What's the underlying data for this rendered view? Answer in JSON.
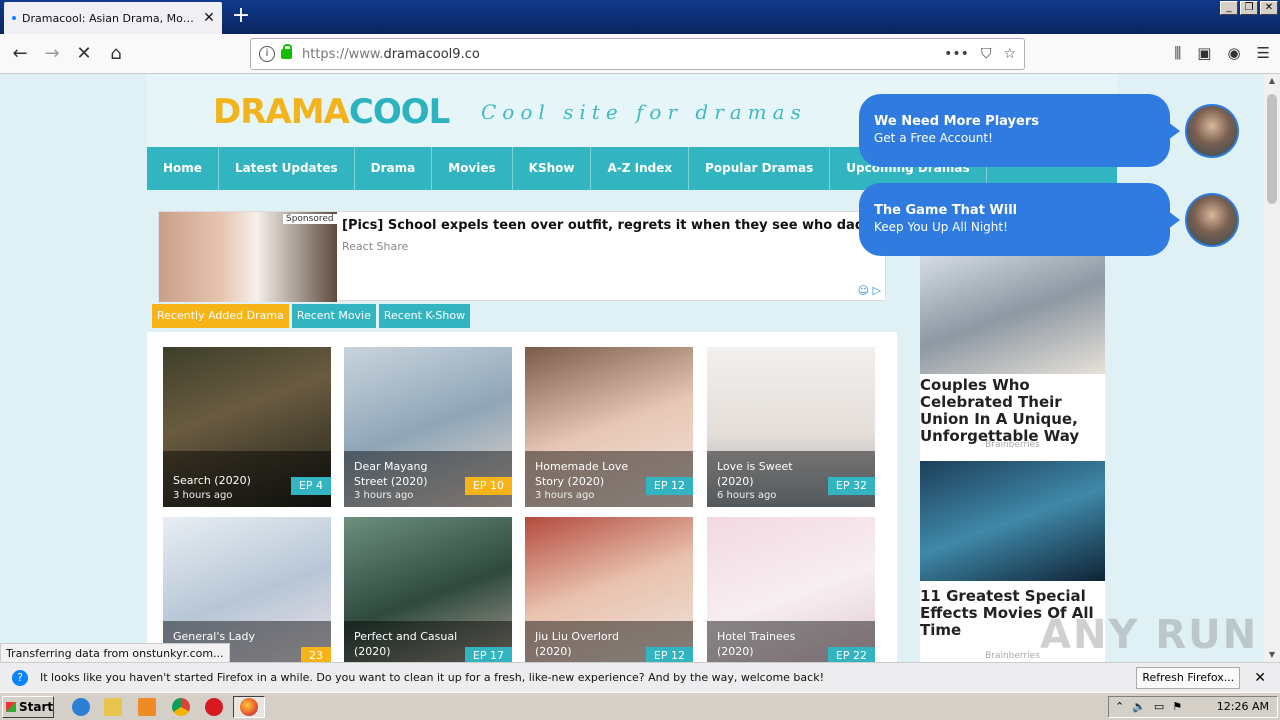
{
  "browser": {
    "tab_title": "Dramacool: Asian Drama, Movies and Shows English Sub",
    "url_prefix": "https://www.",
    "url_domain": "dramacool9.co",
    "page_actions": "•••"
  },
  "site": {
    "logo_a": "DRAMA",
    "logo_b": "COOL",
    "tagline": "Cool site for dramas",
    "menu": [
      "Home",
      "Latest Updates",
      "Drama",
      "Movies",
      "KShow",
      "A-Z Index",
      "Popular Dramas",
      "Upcoming Dramas"
    ]
  },
  "ad": {
    "sponsored": "Sponsored",
    "headline": "[Pics] School expels teen over outfit, regrets it when they see who dad is",
    "source": "React Share"
  },
  "recent_tabs": [
    "Recently Added Drama",
    "Recent Movie",
    "Recent K-Show"
  ],
  "cards": [
    {
      "title": "Search (2020)",
      "time": "3 hours ago",
      "ep": "EP 4",
      "ep_color": "#32b5c1"
    },
    {
      "title": "Dear Mayang Street (2020)",
      "time": "3 hours ago",
      "ep": "EP 10",
      "ep_color": "#f7b418"
    },
    {
      "title": "Homemade Love Story (2020)",
      "time": "3 hours ago",
      "ep": "EP 12",
      "ep_color": "#32b5c1"
    },
    {
      "title": "Love is Sweet (2020)",
      "time": "6 hours ago",
      "ep": "EP 32",
      "ep_color": "#32b5c1"
    },
    {
      "title": "General's Lady",
      "time": "",
      "ep": "23",
      "ep_color": "#f7b418"
    },
    {
      "title": "Perfect and Casual (2020)",
      "time": "",
      "ep": "EP 17",
      "ep_color": "#32b5c1"
    },
    {
      "title": "Jiu Liu Overlord (2020)",
      "time": "",
      "ep": "EP 12",
      "ep_color": "#32b5c1"
    },
    {
      "title": "Hotel Trainees (2020)",
      "time": "",
      "ep": "EP 22",
      "ep_color": "#32b5c1"
    }
  ],
  "side_ads": [
    {
      "headline": "Couples Who Celebrated Their Union In A Unique, Unforgettable Way",
      "source": "Brainberries"
    },
    {
      "headline": "11 Greatest Special Effects Movies Of All Time",
      "source": "Brainberries"
    }
  ],
  "bubbles": [
    {
      "line1": "We Need More Players",
      "line2": "Get a Free Account!"
    },
    {
      "line1": "The Game That Will",
      "line2": "Keep You Up All Night!"
    }
  ],
  "status": "Transferring data from onstunkyr.com...",
  "watermark": "ANY RUN",
  "notification": {
    "message": "It looks like you haven't started Firefox in a while. Do you want to clean it up for a fresh, like-new experience? And by the way, welcome back!",
    "button": "Refresh Firefox..."
  },
  "taskbar": {
    "start": "Start",
    "clock": "12:26 AM"
  }
}
